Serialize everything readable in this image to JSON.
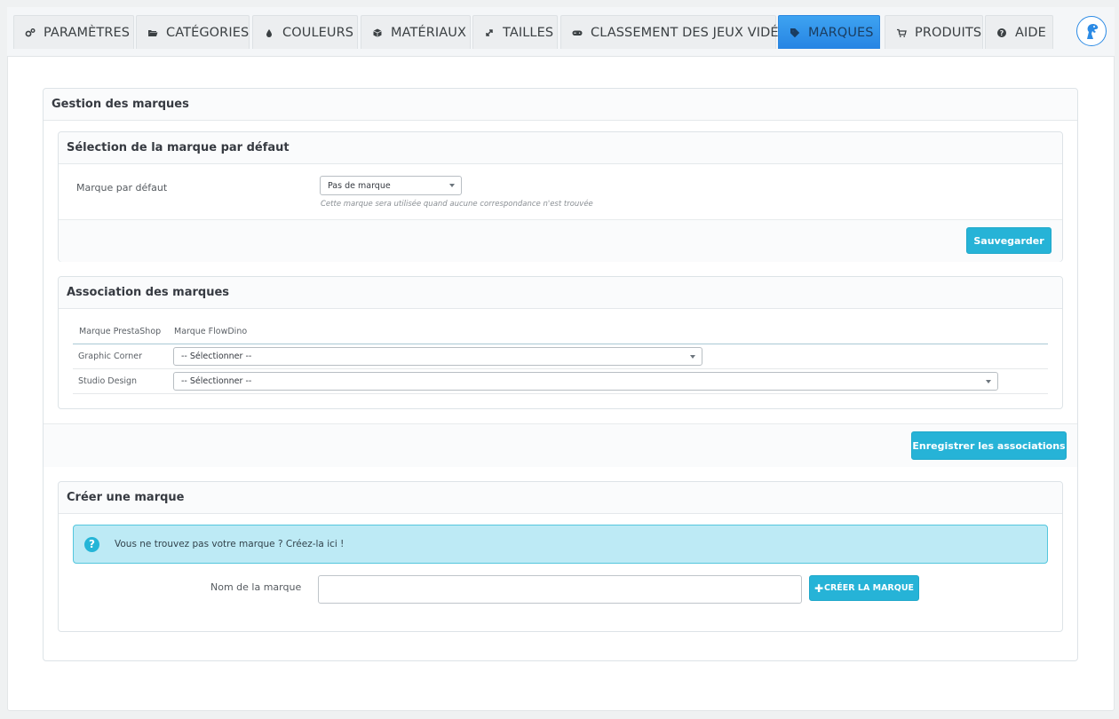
{
  "tabs": [
    {
      "label": "PARAMÈTRES",
      "icon": "gears-icon"
    },
    {
      "label": "CATÉGORIES",
      "icon": "folder-open-icon"
    },
    {
      "label": "COULEURS",
      "icon": "droplet-icon"
    },
    {
      "label": "MATÉRIAUX",
      "icon": "cube-icon"
    },
    {
      "label": "TAILLES",
      "icon": "expand-arrows-icon"
    },
    {
      "label": "CLASSEMENT DES JEUX VIDÉO",
      "icon": "gamepad-icon"
    },
    {
      "label": "MARQUES",
      "icon": "tag-icon",
      "active": true
    },
    {
      "label": "PRODUITS",
      "icon": "cart-icon"
    },
    {
      "label": "AIDE",
      "icon": "question-circle-icon"
    }
  ],
  "logo": {
    "icon": "dino-logo-icon"
  },
  "main": {
    "title": "Gestion des marques",
    "default_brand": {
      "title": "Sélection de la marque par défaut",
      "label": "Marque par défaut",
      "selected": "Pas de marque",
      "hint": "Cette marque sera utilisée quand aucune correspondance n'est trouvée",
      "save_label": "Sauvegarder"
    },
    "association": {
      "title": "Association des marques",
      "col_prestashop": "Marque PrestaShop",
      "col_flowdino": "Marque FlowDino",
      "rows": [
        {
          "brand": "Graphic Corner",
          "selected": "-- Sélectionner --"
        },
        {
          "brand": "Studio Design",
          "selected": "-- Sélectionner --"
        }
      ],
      "save_label": "Enregistrer les associations"
    },
    "create": {
      "title": "Créer une marque",
      "alert": "Vous ne trouvez pas votre marque ? Créez-la ici !",
      "name_label": "Nom de la marque",
      "name_value": "",
      "button_label": "CRÉER LA MARQUE",
      "button_icon": "plus-icon"
    }
  },
  "colors": {
    "accent": "#26b3d7",
    "active_tab": "#2f8fe8",
    "alert_bg": "#bdeaf5"
  }
}
